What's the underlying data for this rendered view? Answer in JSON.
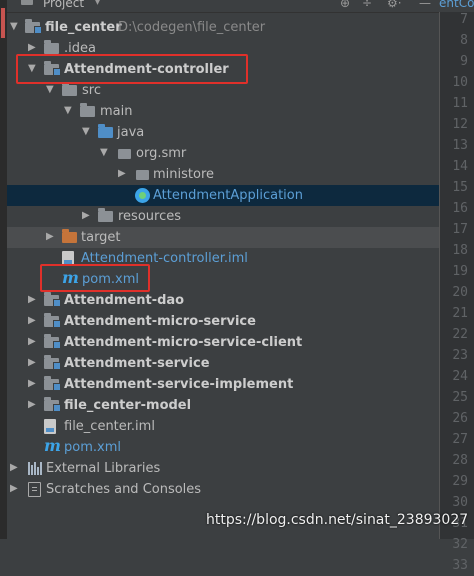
{
  "header": {
    "title": "Project",
    "title_arrow": "▾",
    "tools": [
      "⊕",
      "÷",
      "⚙·",
      "—"
    ]
  },
  "editor_tab": "entCo",
  "tree": [
    {
      "id": "file_center",
      "label": "file_center",
      "path": "D:\\codegen\\file_center",
      "arrow": "▼",
      "icon": "folder-module",
      "bold": true
    },
    {
      "id": "idea",
      "label": ".idea",
      "arrow": "▶",
      "icon": "folder-gray"
    },
    {
      "id": "attendment-controller",
      "label": "Attendment-controller",
      "arrow": "▼",
      "icon": "folder-module",
      "bold": true
    },
    {
      "id": "src",
      "label": "src",
      "arrow": "▼",
      "icon": "folder-gray"
    },
    {
      "id": "main",
      "label": "main",
      "arrow": "▼",
      "icon": "folder-gray"
    },
    {
      "id": "java",
      "label": "java",
      "arrow": "▼",
      "icon": "folder-blue"
    },
    {
      "id": "org-smr",
      "label": "org.smr",
      "arrow": "▼",
      "icon": "pkg"
    },
    {
      "id": "ministore",
      "label": "ministore",
      "arrow": "▶",
      "icon": "pkg"
    },
    {
      "id": "attendment-application",
      "label": "AttendmentApplication",
      "icon": "app",
      "blue": true,
      "selected": true
    },
    {
      "id": "resources",
      "label": "resources",
      "arrow": "▶",
      "icon": "folder-gray"
    },
    {
      "id": "target",
      "label": "target",
      "arrow": "▶",
      "icon": "folder-orange",
      "active": true
    },
    {
      "id": "controller-iml",
      "label": "Attendment-controller.iml",
      "icon": "iml",
      "blue": true
    },
    {
      "id": "controller-pom",
      "label": "pom.xml",
      "icon": "maven",
      "blue": true
    },
    {
      "id": "attendment-dao",
      "label": "Attendment-dao",
      "arrow": "▶",
      "icon": "folder-module",
      "bold": true
    },
    {
      "id": "attendment-micro-service",
      "label": "Attendment-micro-service",
      "arrow": "▶",
      "icon": "folder-module",
      "bold": true
    },
    {
      "id": "attendment-micro-service-client",
      "label": "Attendment-micro-service-client",
      "arrow": "▶",
      "icon": "folder-module",
      "bold": true
    },
    {
      "id": "attendment-service",
      "label": "Attendment-service",
      "arrow": "▶",
      "icon": "folder-module",
      "bold": true
    },
    {
      "id": "attendment-service-implement",
      "label": "Attendment-service-implement",
      "arrow": "▶",
      "icon": "folder-module",
      "bold": true
    },
    {
      "id": "file-center-model",
      "label": "file_center-model",
      "arrow": "▶",
      "icon": "folder-module",
      "bold": true
    },
    {
      "id": "file-center-iml",
      "label": "file_center.iml",
      "icon": "iml"
    },
    {
      "id": "root-pom",
      "label": "pom.xml",
      "icon": "maven",
      "blue": true
    },
    {
      "id": "external-libraries",
      "label": "External Libraries",
      "arrow": "▶",
      "icon": "library"
    },
    {
      "id": "scratches",
      "label": "Scratches and Consoles",
      "arrow": "▶",
      "icon": "scratch"
    }
  ],
  "line_numbers": [
    "7",
    "8",
    "9",
    "10",
    "11",
    "12",
    "13",
    "14",
    "15",
    "16",
    "17",
    "18",
    "19",
    "20",
    "21",
    "22",
    "23",
    "24",
    "25",
    "26",
    "27",
    "28",
    "29",
    "30",
    "31",
    "32",
    "33"
  ],
  "watermark": "https://blog.csdn.net/sinat_23893027",
  "colors": {
    "background": "#3c3f41",
    "selection": "#0d293e",
    "highlight_box": "#e0302a",
    "link_blue": "#5c9fd6"
  }
}
